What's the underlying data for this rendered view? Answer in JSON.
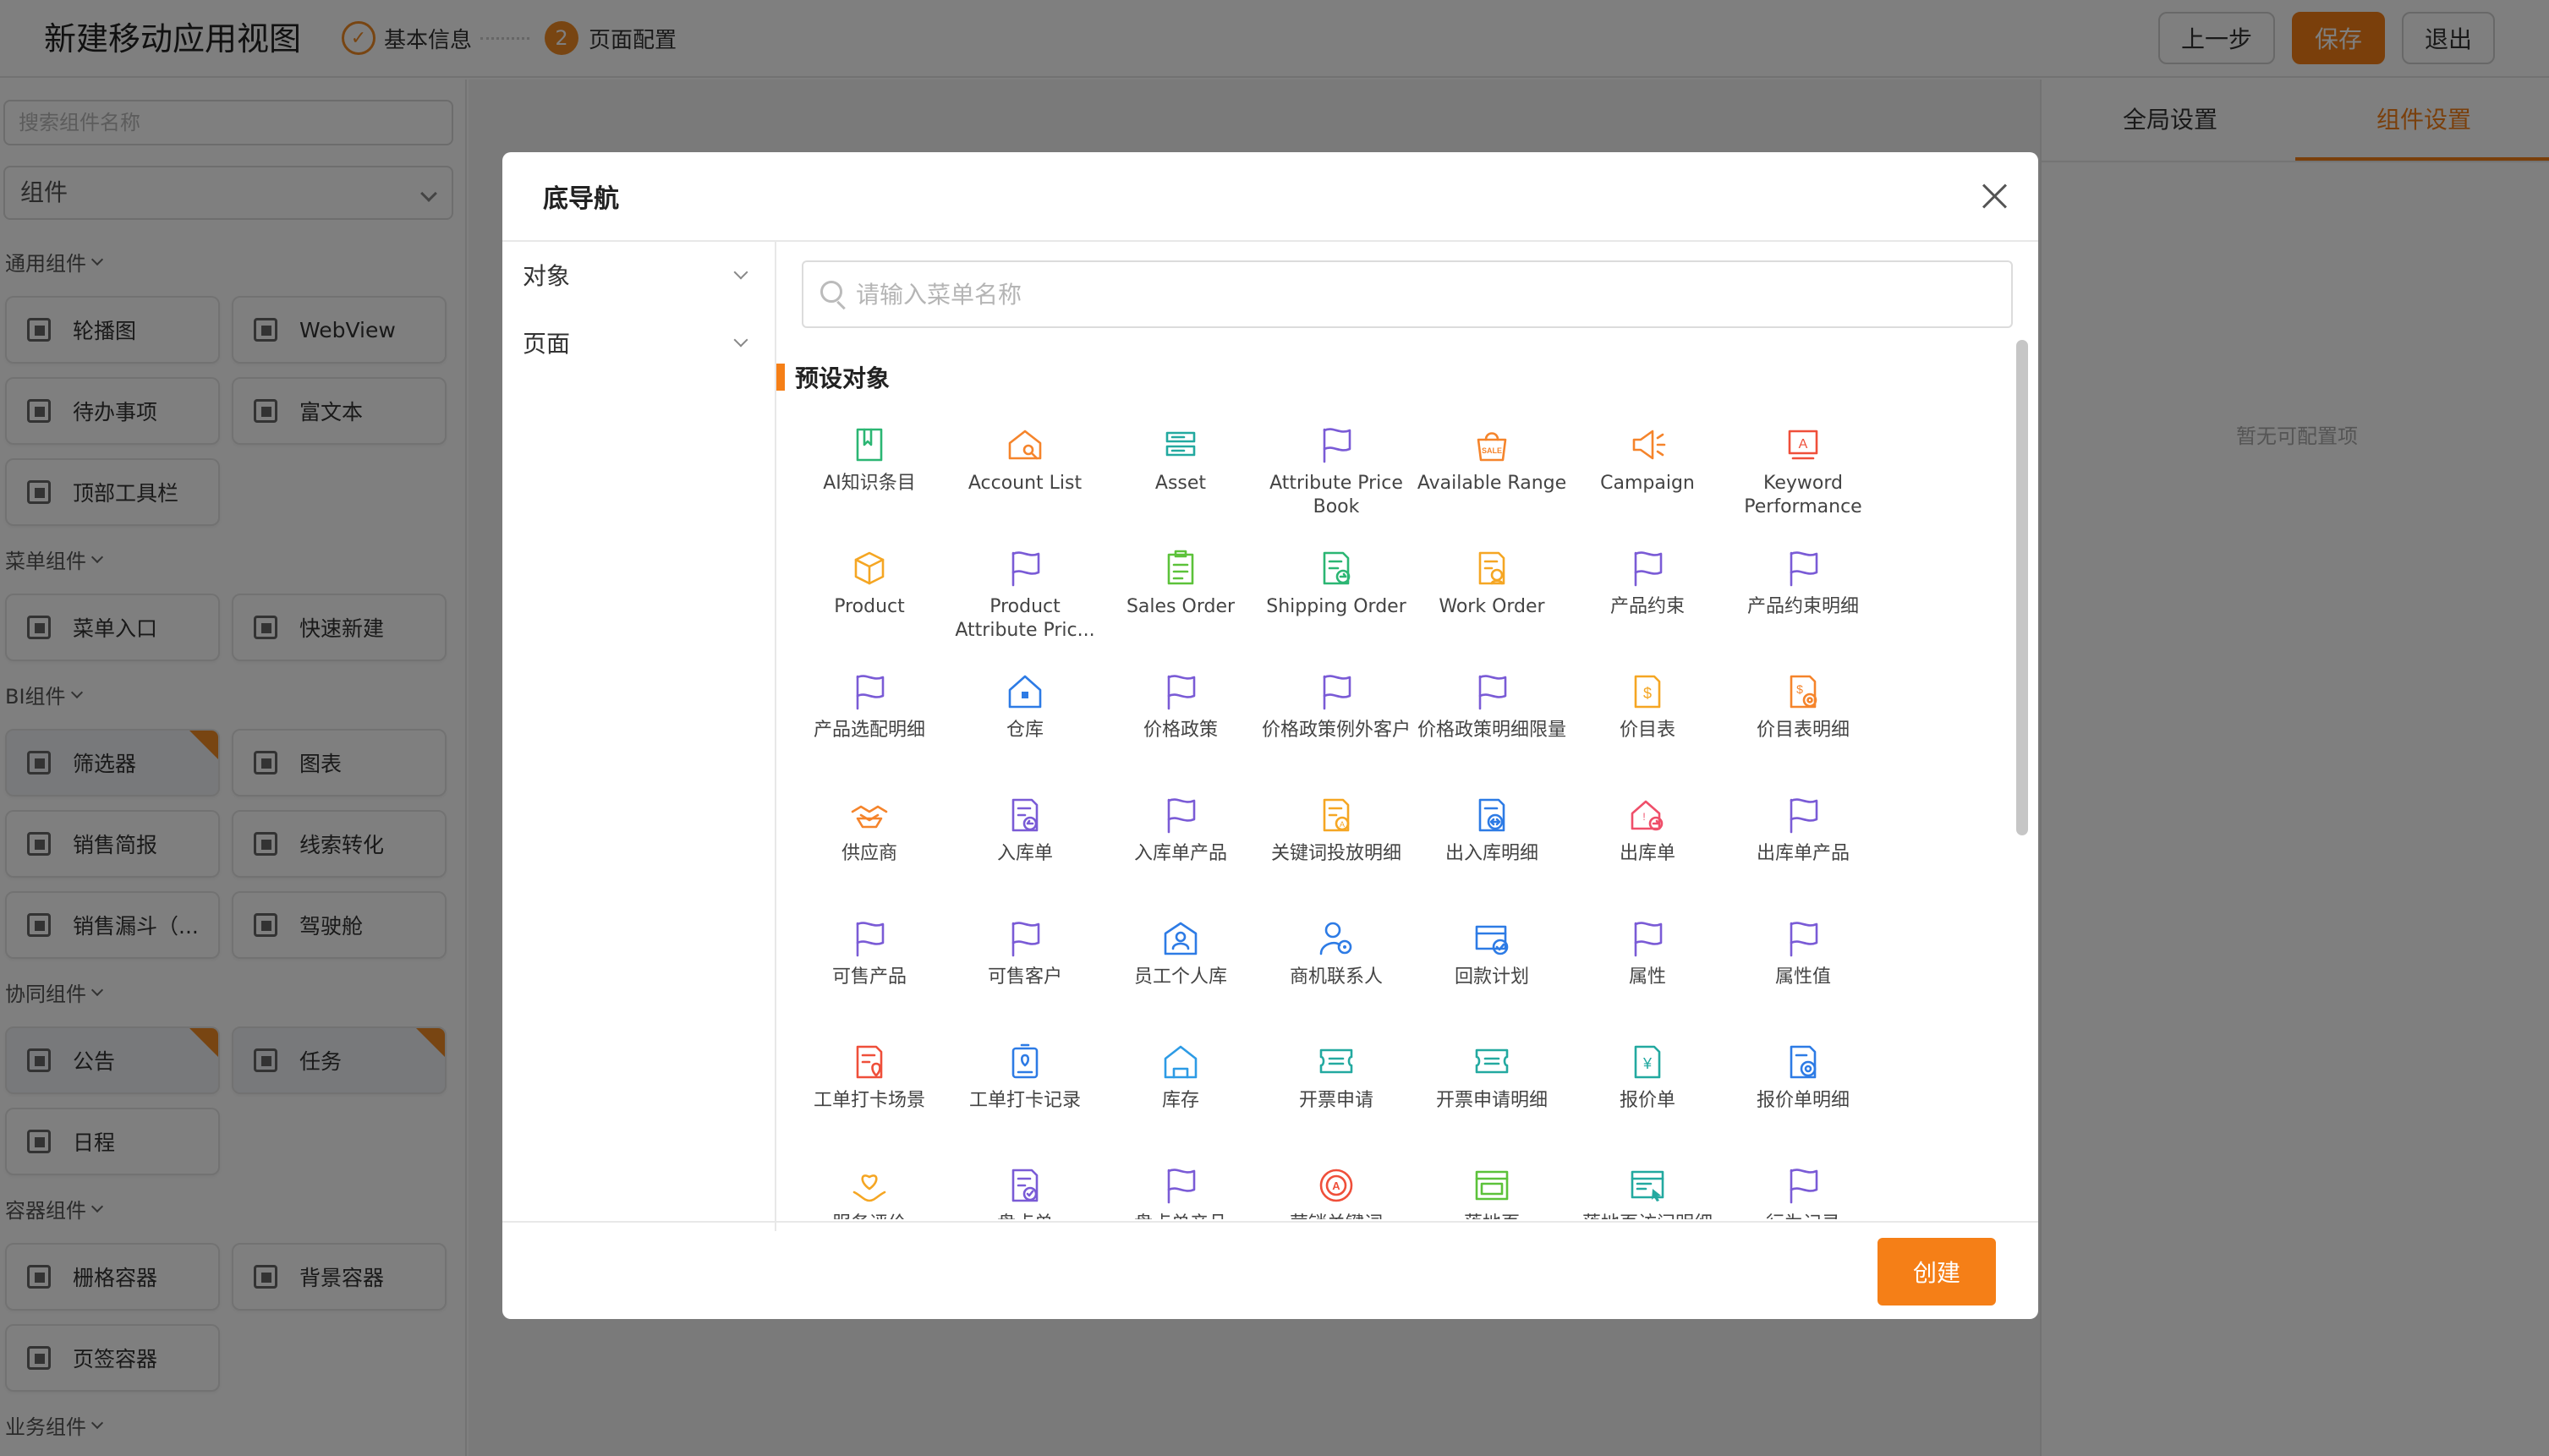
{
  "header": {
    "title": "新建移动应用视图",
    "steps": [
      {
        "label": "基本信息",
        "state": "done"
      },
      {
        "num": "2",
        "label": "页面配置",
        "state": "active"
      }
    ],
    "prev_label": "上一步",
    "save_label": "保存",
    "exit_label": "退出",
    "accent_color": "#f57f17"
  },
  "left": {
    "search_placeholder": "搜索组件名称",
    "dropdown_value": "组件",
    "groups": [
      {
        "title": "通用组件",
        "items": [
          "轮播图",
          "WebView",
          "待办事项",
          "富文本",
          "顶部工具栏"
        ]
      },
      {
        "title": "菜单组件",
        "items": [
          "菜单入口",
          "快速新建"
        ]
      },
      {
        "title": "BI组件",
        "items": [
          "筛选器",
          "图表",
          "销售简报",
          "线索转化",
          "销售漏斗（...",
          "驾驶舱"
        ]
      },
      {
        "title": "协同组件",
        "items": [
          "公告",
          "任务",
          "日程"
        ]
      },
      {
        "title": "容器组件",
        "items": [
          "栅格容器",
          "背景容器",
          "页签容器"
        ]
      },
      {
        "title": "业务组件",
        "items": []
      }
    ]
  },
  "right": {
    "tabs": [
      "全局设置",
      "组件设置"
    ],
    "active_tab": "组件设置",
    "empty_text": "暂无可配置项"
  },
  "modal": {
    "title": "底导航",
    "categories": [
      "对象",
      "页面"
    ],
    "search_placeholder": "请输入菜单名称",
    "section_title": "预设对象",
    "create_label": "创建",
    "items": [
      {
        "label": "AI知识条目",
        "icon": "book-icon",
        "color": "#2bb673"
      },
      {
        "label": "Account List",
        "icon": "home-search-icon",
        "color": "#f5842b"
      },
      {
        "label": "Asset",
        "icon": "server-icon",
        "color": "#23a9a0"
      },
      {
        "label": "Attribute Price Book",
        "icon": "flag-icon",
        "color": "#7a5bd6"
      },
      {
        "label": "Available Range",
        "icon": "sale-bag-icon",
        "color": "#f5842b"
      },
      {
        "label": "Campaign",
        "icon": "megaphone-icon",
        "color": "#f5842b"
      },
      {
        "label": "Keyword Performance",
        "icon": "keyword-icon",
        "color": "#ef4f3a"
      },
      {
        "label": "Product",
        "icon": "box-icon",
        "color": "#f5a623"
      },
      {
        "label": "Product Attribute Pric...",
        "icon": "flag-icon",
        "color": "#7a5bd6"
      },
      {
        "label": "Sales Order",
        "icon": "clipboard-icon",
        "color": "#5cc23a"
      },
      {
        "label": "Shipping Order",
        "icon": "shipping-doc-icon",
        "color": "#2bb673"
      },
      {
        "label": "Work Order",
        "icon": "work-doc-icon",
        "color": "#f5a623"
      },
      {
        "label": "产品约束",
        "icon": "flag-icon",
        "color": "#7a5bd6"
      },
      {
        "label": "产品约束明细",
        "icon": "flag-icon",
        "color": "#7a5bd6"
      },
      {
        "label": "产品选配明细",
        "icon": "flag-icon",
        "color": "#7a5bd6"
      },
      {
        "label": "仓库",
        "icon": "warehouse-icon",
        "color": "#2d7be5"
      },
      {
        "label": "价格政策",
        "icon": "flag-icon",
        "color": "#7a5bd6"
      },
      {
        "label": "价格政策例外客户",
        "icon": "flag-icon",
        "color": "#7a5bd6"
      },
      {
        "label": "价格政策明细限量",
        "icon": "flag-icon",
        "color": "#7a5bd6"
      },
      {
        "label": "价目表",
        "icon": "dollar-doc-icon",
        "color": "#f5a623"
      },
      {
        "label": "价目表明细",
        "icon": "dollar-gear-icon",
        "color": "#f5842b"
      },
      {
        "label": "供应商",
        "icon": "handshake-icon",
        "color": "#f5842b"
      },
      {
        "label": "入库单",
        "icon": "inbound-doc-icon",
        "color": "#7a5bd6"
      },
      {
        "label": "入库单产品",
        "icon": "flag-icon",
        "color": "#7a5bd6"
      },
      {
        "label": "关键词投放明细",
        "icon": "keyword-doc-icon",
        "color": "#f5a623"
      },
      {
        "label": "出入库明细",
        "icon": "transfer-doc-icon",
        "color": "#2d7be5"
      },
      {
        "label": "出库单",
        "icon": "outbound-home-icon",
        "color": "#ef4f6a"
      },
      {
        "label": "出库单产品",
        "icon": "flag-icon",
        "color": "#7a5bd6"
      },
      {
        "label": "可售产品",
        "icon": "flag-icon",
        "color": "#7a5bd6"
      },
      {
        "label": "可售客户",
        "icon": "flag-icon",
        "color": "#7a5bd6"
      },
      {
        "label": "员工个人库",
        "icon": "person-home-icon",
        "color": "#2d7be5"
      },
      {
        "label": "商机联系人",
        "icon": "contact-icon",
        "color": "#2d7be5"
      },
      {
        "label": "回款计划",
        "icon": "payment-plan-icon",
        "color": "#2d7be5"
      },
      {
        "label": "属性",
        "icon": "flag-icon",
        "color": "#7a5bd6"
      },
      {
        "label": "属性值",
        "icon": "flag-icon",
        "color": "#7a5bd6"
      },
      {
        "label": "工单打卡场景",
        "icon": "checkin-doc-icon",
        "color": "#ef4f3a"
      },
      {
        "label": "工单打卡记录",
        "icon": "checkin-badge-icon",
        "color": "#2d7be5"
      },
      {
        "label": "库存",
        "icon": "inventory-home-icon",
        "color": "#2d9be5"
      },
      {
        "label": "开票申请",
        "icon": "ticket-icon",
        "color": "#23a9a0"
      },
      {
        "label": "开票申请明细",
        "icon": "ticket-icon",
        "color": "#23a9a0"
      },
      {
        "label": "报价单",
        "icon": "yen-doc-icon",
        "color": "#23a9a0"
      },
      {
        "label": "报价单明细",
        "icon": "quote-gear-icon",
        "color": "#2d7be5"
      },
      {
        "label": "服务评价",
        "icon": "heart-hand-icon",
        "color": "#f5a623"
      },
      {
        "label": "盘点单",
        "icon": "check-doc-icon",
        "color": "#7a5bd6"
      },
      {
        "label": "盘点单产品",
        "icon": "flag-icon",
        "color": "#7a5bd6"
      },
      {
        "label": "营销关键词",
        "icon": "keyword-target-icon",
        "color": "#ef4f3a"
      },
      {
        "label": "落地页",
        "icon": "browser-page-icon",
        "color": "#5cc23a"
      },
      {
        "label": "落地页访问明细",
        "icon": "browser-click-icon",
        "color": "#23a9a0"
      },
      {
        "label": "行为记录",
        "icon": "flag-icon",
        "color": "#7a5bd6"
      }
    ]
  }
}
